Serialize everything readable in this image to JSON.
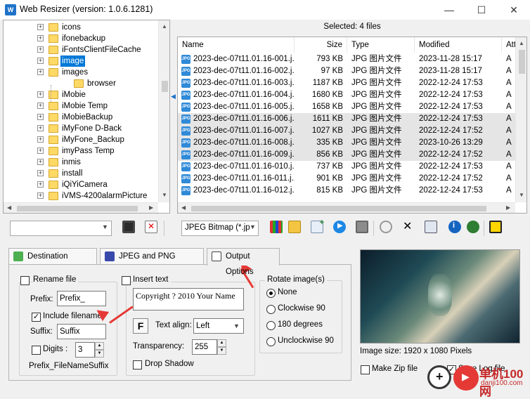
{
  "window": {
    "title": "Web Resizer (version: 1.0.6.1281)",
    "minimize": "—",
    "maximize": "☐",
    "close": "✕",
    "app_icon": "W"
  },
  "tree": {
    "items": [
      {
        "label": "icons",
        "level": 1,
        "expander": true
      },
      {
        "label": "ifonebackup",
        "level": 1,
        "expander": true
      },
      {
        "label": "iFontsClientFileCache",
        "level": 1,
        "expander": true
      },
      {
        "label": "image",
        "level": 1,
        "expander": true,
        "selected": true
      },
      {
        "label": "images",
        "level": 1,
        "expander": true
      },
      {
        "label": "browser",
        "level": 2,
        "expander": false
      },
      {
        "label": "iMobie",
        "level": 1,
        "expander": true
      },
      {
        "label": "iMobie Temp",
        "level": 1,
        "expander": true
      },
      {
        "label": "iMobieBackup",
        "level": 1,
        "expander": true
      },
      {
        "label": "iMyFone D-Back",
        "level": 1,
        "expander": true
      },
      {
        "label": "iMyFone_Backup",
        "level": 1,
        "expander": true
      },
      {
        "label": "imyPass Temp",
        "level": 1,
        "expander": true
      },
      {
        "label": "inmis",
        "level": 1,
        "expander": true
      },
      {
        "label": "install",
        "level": 1,
        "expander": true
      },
      {
        "label": "iQiYiCamera",
        "level": 1,
        "expander": true
      },
      {
        "label": "iVMS-4200alarmPicture",
        "level": 1,
        "expander": true
      }
    ]
  },
  "filelist": {
    "selected_label": "Selected: 4 files",
    "columns": [
      "Name",
      "Size",
      "Type",
      "Modified",
      "Att"
    ],
    "icon_text": "JPG",
    "rows": [
      {
        "name": "2023-dec-07t11.01.16-001.j...",
        "size": "793 KB",
        "type": "JPG 图片文件",
        "modified": "2023-11-28 15:17",
        "attr": "A",
        "selected": false
      },
      {
        "name": "2023-dec-07t11.01.16-002.j...",
        "size": "97 KB",
        "type": "JPG 图片文件",
        "modified": "2023-11-28 15:17",
        "attr": "A",
        "selected": false
      },
      {
        "name": "2023-dec-07t11.01.16-003.j...",
        "size": "1187 KB",
        "type": "JPG 图片文件",
        "modified": "2022-12-24 17:53",
        "attr": "A",
        "selected": false
      },
      {
        "name": "2023-dec-07t11.01.16-004.j...",
        "size": "1680 KB",
        "type": "JPG 图片文件",
        "modified": "2022-12-24 17:53",
        "attr": "A",
        "selected": false
      },
      {
        "name": "2023-dec-07t11.01.16-005.j...",
        "size": "1658 KB",
        "type": "JPG 图片文件",
        "modified": "2022-12-24 17:53",
        "attr": "A",
        "selected": false
      },
      {
        "name": "2023-dec-07t11.01.16-006.j...",
        "size": "1611 KB",
        "type": "JPG 图片文件",
        "modified": "2022-12-24 17:53",
        "attr": "A",
        "selected": true
      },
      {
        "name": "2023-dec-07t11.01.16-007.j...",
        "size": "1027 KB",
        "type": "JPG 图片文件",
        "modified": "2022-12-24 17:52",
        "attr": "A",
        "selected": true
      },
      {
        "name": "2023-dec-07t11.01.16-008.j...",
        "size": "335 KB",
        "type": "JPG 图片文件",
        "modified": "2023-10-26 13:29",
        "attr": "A",
        "selected": true
      },
      {
        "name": "2023-dec-07t11.01.16-009.j...",
        "size": "856 KB",
        "type": "JPG 图片文件",
        "modified": "2022-12-24 17:52",
        "attr": "A",
        "selected": true
      },
      {
        "name": "2023-dec-07t11.01.16-010.j...",
        "size": "737 KB",
        "type": "JPG 图片文件",
        "modified": "2022-12-24 17:53",
        "attr": "A",
        "selected": false
      },
      {
        "name": "2023-dec-07t11.01.16-011.j...",
        "size": "901 KB",
        "type": "JPG 图片文件",
        "modified": "2022-12-24 17:52",
        "attr": "A",
        "selected": false
      },
      {
        "name": "2023-dec-07t11.01.16-012.j...",
        "size": "815 KB",
        "type": "JPG 图片文件",
        "modified": "2022-12-24 17:53",
        "attr": "A",
        "selected": false
      }
    ]
  },
  "toolbar": {
    "save_profile_value": "",
    "format_value": "JPEG Bitmap (*.jp",
    "icons": [
      "save-icon",
      "delete-profile-icon",
      "grid-view-icon",
      "copy-icon",
      "add-files-icon",
      "play-icon",
      "stop-icon",
      "zoom-icon",
      "remove-icon",
      "compare-icon",
      "info-icon",
      "web-icon",
      "exit-icon"
    ]
  },
  "tabs": {
    "destination": "Destination Settings",
    "jpeg_png": "JPEG and PNG Settings",
    "output": "Output Options"
  },
  "output": {
    "rename_label": "Rename file",
    "prefix_label": "Prefix:",
    "prefix_value": "Prefix_",
    "include_filename_label": "Include filename",
    "include_filename_checked": "✓",
    "suffix_label": "Suffix:",
    "suffix_value": "Suffix",
    "digits_label": "Digits :",
    "digits_value": "3",
    "example": "Prefix_FileNameSuffix",
    "insert_text_label": "Insert text",
    "insert_text_value": "Copyright ? 2010 Your Name",
    "font_button": "F",
    "text_align_label": "Text align:",
    "text_align_value": "Left",
    "transparency_label": "Transparency:",
    "transparency_value": "255",
    "drop_shadow_label": "Drop Shadow",
    "rotate_title": "Rotate image(s)",
    "rotate_options": [
      "None",
      "Clockwise 90",
      "180 degrees",
      "Unclockwise 90"
    ],
    "rotate_selected": "None"
  },
  "preview": {
    "image_size": "Image size: 1920 x 1080 Pixels",
    "make_zip_label": "Make Zip file",
    "save_log_label": "Save Log file",
    "save_log_checked": "✓"
  },
  "watermark": {
    "text": "单机100网",
    "subtext": "danji100.com"
  },
  "colors": {
    "selection": "#0078d7",
    "row_selected": "#e5e5e5",
    "annotation": "#e53935",
    "folder": "#ffd966"
  }
}
